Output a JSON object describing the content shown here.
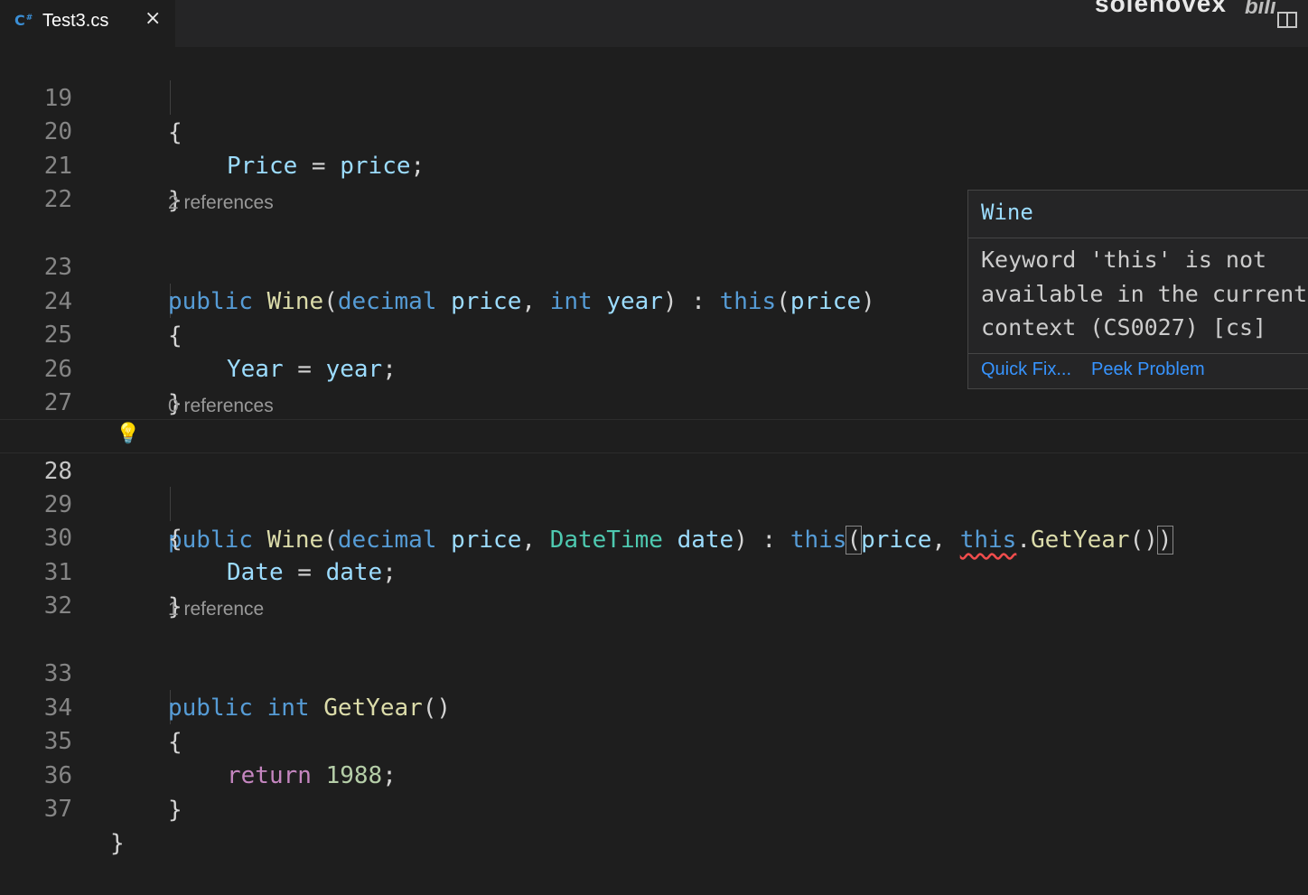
{
  "tab": {
    "icon": "csharp-file-icon",
    "file_name": "Test3.cs",
    "close_label": "×"
  },
  "watermark": {
    "text": "solenovex",
    "logo": "bili"
  },
  "codelens": {
    "ctor_year": "2 references",
    "ctor_date": "0 references",
    "getyear": "1 reference"
  },
  "lines": {
    "l19": {
      "num": "19",
      "brace": "{"
    },
    "l20": {
      "num": "20",
      "lhs": "Price",
      "op": " = ",
      "rhs": "price",
      "end": ";"
    },
    "l21": {
      "num": "21",
      "brace": "}"
    },
    "l22": {
      "num": "22"
    },
    "l23": {
      "num": "23",
      "t1": "public",
      "t2": "Wine",
      "t3": "(",
      "t4": "decimal",
      "t5": "price",
      "t6": ", ",
      "t7": "int",
      "t8": "year",
      "t9": ") : ",
      "t10": "this",
      "t11": "(",
      "t12": "price",
      "t13": ")"
    },
    "l24": {
      "num": "24",
      "brace": "{"
    },
    "l25": {
      "num": "25",
      "lhs": "Year",
      "op": " = ",
      "rhs": "year",
      "end": ";"
    },
    "l26": {
      "num": "26",
      "brace": "}"
    },
    "l27": {
      "num": "27"
    },
    "l28": {
      "num": "28",
      "t1": "public",
      "t2": "Wine",
      "t3": "(",
      "t4": "decimal",
      "t5": "price",
      "t6": ", ",
      "t7": "DateTime",
      "t8": "date",
      "t9": ") : ",
      "t10": "this",
      "t11": "(",
      "t12": "price",
      "t13": ", ",
      "t14": "this",
      "t15": ".",
      "t16": "GetYear",
      "t17": "()",
      "t18": ")"
    },
    "l29": {
      "num": "29",
      "brace": "{"
    },
    "l30": {
      "num": "30",
      "lhs": "Date",
      "op": " = ",
      "rhs": "date",
      "end": ";"
    },
    "l31": {
      "num": "31",
      "brace": "}"
    },
    "l32": {
      "num": "32"
    },
    "l33": {
      "num": "33",
      "t1": "public",
      "t2": "int",
      "t3": "GetYear",
      "t4": "()"
    },
    "l34": {
      "num": "34",
      "brace": "{"
    },
    "l35": {
      "num": "35",
      "t1": "return",
      "t2": "1988",
      "t3": ";"
    },
    "l36": {
      "num": "36",
      "brace": "}"
    },
    "l37": {
      "num": "37",
      "brace": "}"
    }
  },
  "hover": {
    "title": "Wine",
    "message": "Keyword 'this' is not\navailable in the current\ncontext (CS0027) [cs]",
    "quick_fix": "Quick Fix...",
    "peek_problem": "Peek Problem"
  },
  "colors": {
    "background": "#1e1e1e",
    "keyword": "#569cd6",
    "function": "#dcdcaa",
    "type": "#4ec9b0",
    "variable": "#9cdcfe",
    "control": "#c586c0",
    "number": "#b5cea8",
    "link": "#3794ff",
    "error": "#f14c4c",
    "lightbulb": "#ffcc00"
  }
}
